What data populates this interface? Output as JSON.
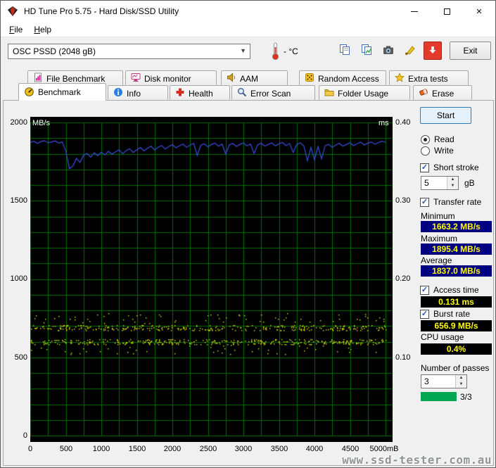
{
  "window": {
    "title": "HD Tune Pro 5.75 - Hard Disk/SSD Utility"
  },
  "menu": {
    "items": [
      {
        "label": "File"
      },
      {
        "label": "Help"
      }
    ]
  },
  "toolbar": {
    "drive_select": "OSC PSSD (2048 gB)",
    "temperature": "- °C",
    "exit_label": "Exit"
  },
  "tabs": {
    "row1": [
      {
        "label": "File Benchmark"
      },
      {
        "label": "Disk monitor"
      },
      {
        "label": "AAM"
      },
      {
        "label": "Random Access"
      },
      {
        "label": "Extra tests"
      }
    ],
    "row2": [
      {
        "label": "Benchmark",
        "active": true
      },
      {
        "label": "Info"
      },
      {
        "label": "Health"
      },
      {
        "label": "Error Scan"
      },
      {
        "label": "Folder Usage"
      },
      {
        "label": "Erase"
      }
    ]
  },
  "controls": {
    "start_label": "Start",
    "read_label": "Read",
    "write_label": "Write",
    "short_stroke_label": "Short stroke",
    "short_stroke_value": "5",
    "short_stroke_unit": "gB",
    "transfer_rate_label": "Transfer rate",
    "minimum_label": "Minimum",
    "minimum_value": "1663.2 MB/s",
    "maximum_label": "Maximum",
    "maximum_value": "1895.4 MB/s",
    "average_label": "Average",
    "average_value": "1837.0 MB/s",
    "access_time_label": "Access time",
    "access_time_value": "0.131 ms",
    "burst_rate_label": "Burst rate",
    "burst_rate_value": "656.9 MB/s",
    "cpu_usage_label": "CPU usage",
    "cpu_usage_value": "0.4%",
    "passes_label": "Number of passes",
    "passes_value": "3",
    "passes_progress": "3/3"
  },
  "watermark": "www.ssd-tester.com.au",
  "chart_data": {
    "type": "line",
    "title": "HD Tune Pro benchmark - transfer rate and access time",
    "x_axis": {
      "min": 0,
      "max": 5000,
      "labels": [
        "0",
        "500",
        "1000",
        "1500",
        "2000",
        "2500",
        "3000",
        "3500",
        "4000",
        "4500",
        "5000mB"
      ]
    },
    "y_left": {
      "label": "MB/s",
      "min": 0,
      "max": 2000,
      "labels": [
        "2000",
        "1500",
        "1000",
        "500",
        "0"
      ]
    },
    "y_right": {
      "label": "ms",
      "min": 0,
      "max": 0.4,
      "labels": [
        "0.40",
        "0.30",
        "0.20",
        "0.10"
      ]
    },
    "grid": {
      "on": true,
      "color": "#006e00",
      "x_step": 250,
      "y_step": 100
    },
    "legend": "none",
    "series": [
      {
        "name": "transfer_rate_read",
        "type": "line",
        "color": "#3a4fe0",
        "axis": "left",
        "x_start": 0,
        "x_step": 50,
        "values": [
          1872,
          1880,
          1866,
          1878,
          1884,
          1870,
          1876,
          1882,
          1868,
          1875,
          1820,
          1705,
          1722,
          1770,
          1745,
          1790,
          1802,
          1778,
          1806,
          1788,
          1810,
          1792,
          1815,
          1798,
          1812,
          1825,
          1800,
          1820,
          1832,
          1808,
          1826,
          1840,
          1818,
          1836,
          1848,
          1824,
          1842,
          1852,
          1830,
          1846,
          1858,
          1838,
          1852,
          1862,
          1842,
          1856,
          1866,
          1790,
          1854,
          1864,
          1844,
          1860,
          1868,
          1848,
          1862,
          1798,
          1856,
          1866,
          1846,
          1860,
          1870,
          1850,
          1862,
          1802,
          1858,
          1868,
          1848,
          1860,
          1870,
          1850,
          1864,
          1872,
          1852,
          1866,
          1808,
          1860,
          1870,
          1850,
          1756,
          1840,
          1762,
          1846,
          1768,
          1852,
          1860,
          1842,
          1856,
          1866,
          1848,
          1860,
          1870,
          1852,
          1864,
          1874,
          1856,
          1868,
          1876,
          1860,
          1872,
          1880,
          1874
        ]
      },
      {
        "name": "access_time",
        "type": "scatter",
        "color": "#e6e600",
        "axis": "right",
        "distribution": {
          "seed": 1337,
          "count": 760,
          "x_min": 0,
          "x_max": 5000,
          "band1_ms": 0.138,
          "band2_ms": 0.12,
          "band_spread_ms": 0.007,
          "outlier_high_min_ms": 0.141,
          "outlier_high_max_ms": 0.157,
          "outlier_low_min_ms": 0.104,
          "outlier_low_max_ms": 0.116
        }
      }
    ]
  }
}
